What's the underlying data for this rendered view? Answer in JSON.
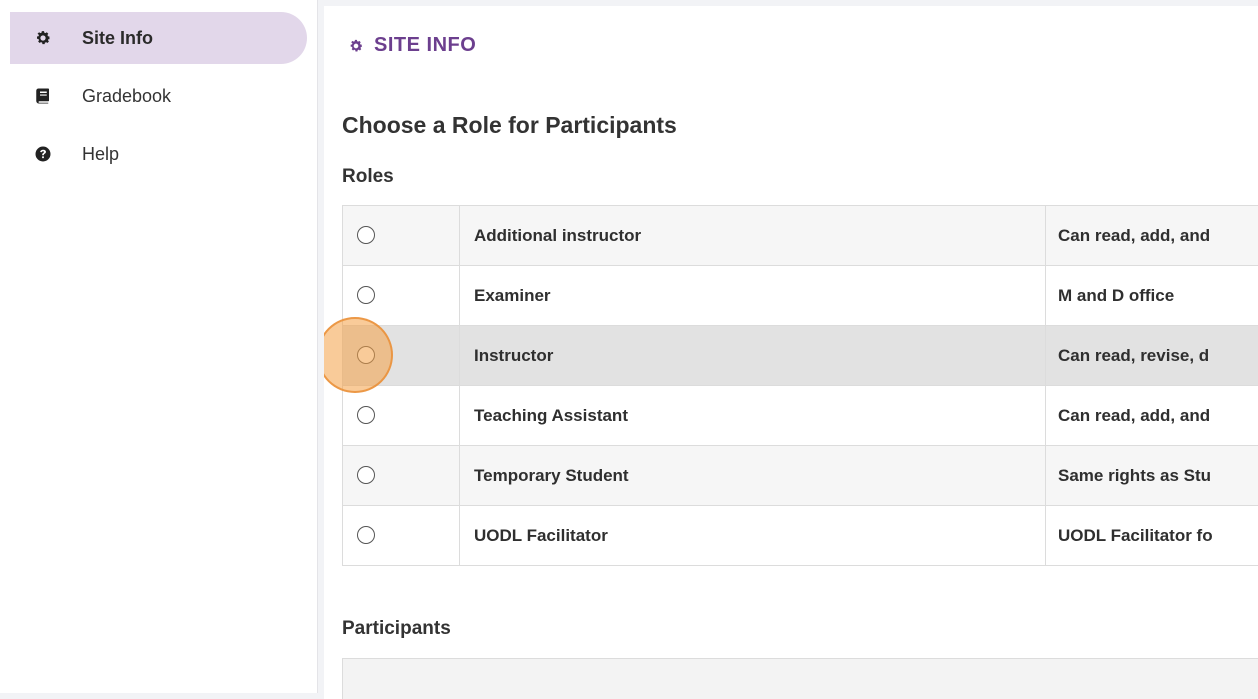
{
  "sidebar": {
    "items": [
      {
        "label": "Site Info",
        "icon": "gear-icon",
        "active": true
      },
      {
        "label": "Gradebook",
        "icon": "book-icon",
        "active": false
      },
      {
        "label": "Help",
        "icon": "question-circle-icon",
        "active": false
      }
    ]
  },
  "main": {
    "title": "SITE INFO",
    "heading": "Choose a Role for Participants",
    "roles_label": "Roles",
    "participants_label": "Participants"
  },
  "roles": [
    {
      "name": "Additional instructor",
      "description": "Can read, add, and",
      "selected": false
    },
    {
      "name": "Examiner",
      "description": "M and D office",
      "selected": false
    },
    {
      "name": "Instructor",
      "description": "Can read, revise, d",
      "selected": false
    },
    {
      "name": "Teaching Assistant",
      "description": "Can read, add, and",
      "selected": false
    },
    {
      "name": "Temporary Student",
      "description": "Same rights as Stu",
      "selected": false
    },
    {
      "name": "UODL Facilitator",
      "description": "UODL Facilitator fo",
      "selected": false
    }
  ],
  "colors": {
    "accent": "#6c3f8e",
    "active_nav_bg": "#e2d7ea",
    "click_highlight": "#f4a046"
  }
}
